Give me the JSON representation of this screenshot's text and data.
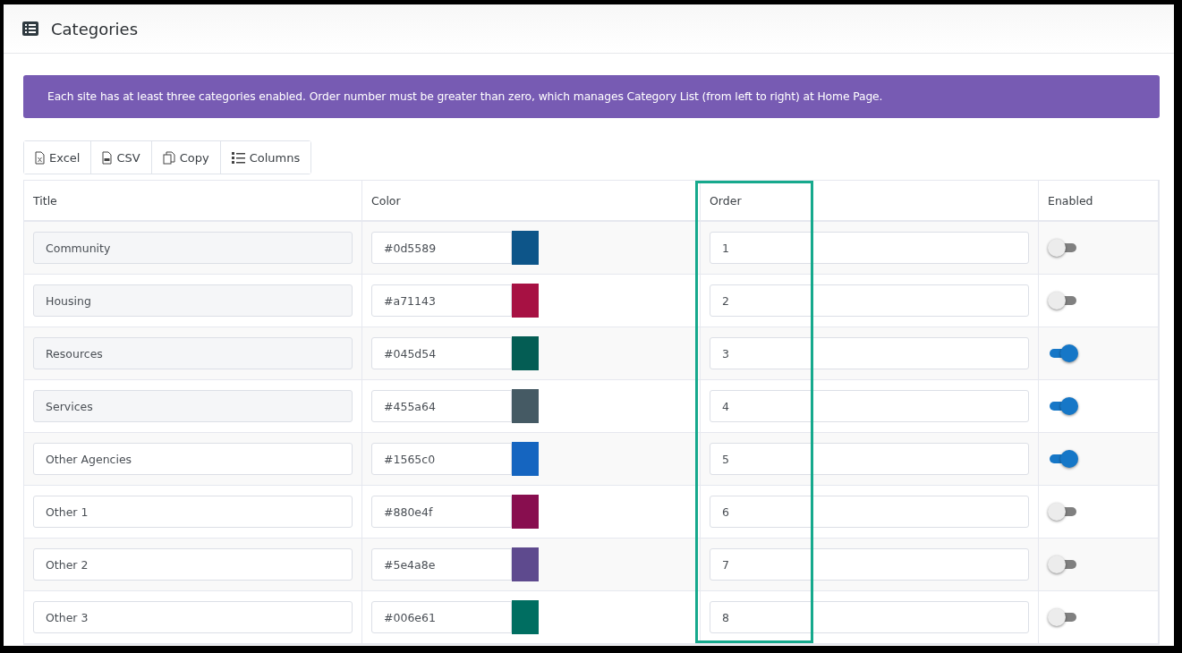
{
  "header": {
    "title": "Categories"
  },
  "alert": {
    "text": "Each site has at least three categories enabled. Order number must be greater than zero, which manages Category List (from left to right) at Home Page."
  },
  "toolbar": [
    {
      "label": "Excel",
      "kind": "excel"
    },
    {
      "label": "CSV",
      "kind": "csv"
    },
    {
      "label": "Copy",
      "kind": "copy"
    },
    {
      "label": "Columns",
      "kind": "columns"
    }
  ],
  "table": {
    "columns": [
      {
        "label": "Title",
        "highlighted": false
      },
      {
        "label": "Color",
        "highlighted": false
      },
      {
        "label": "Order",
        "highlighted": true
      },
      {
        "label": "Enabled",
        "highlighted": false
      }
    ],
    "rows": [
      {
        "title": "Community",
        "disabled": true,
        "color_value": "#0d5589",
        "color": "#0d5589",
        "order": "1",
        "enabled": false
      },
      {
        "title": "Housing",
        "disabled": true,
        "color_value": "#a71143",
        "color": "#a71143",
        "order": "2",
        "enabled": false
      },
      {
        "title": "Resources",
        "disabled": true,
        "color_value": "#045d54",
        "color": "#045d54",
        "order": "3",
        "enabled": true
      },
      {
        "title": "Services",
        "disabled": true,
        "color_value": "#455a64",
        "color": "#455a64",
        "order": "4",
        "enabled": true
      },
      {
        "title": "Other Agencies",
        "disabled": false,
        "color_value": "#1565c0",
        "color": "#1565c0",
        "order": "5",
        "enabled": true
      },
      {
        "title": "Other 1",
        "disabled": false,
        "color_value": "#880e4f",
        "color": "#880e4f",
        "order": "6",
        "enabled": false
      },
      {
        "title": "Other 2",
        "disabled": false,
        "color_value": "#5e4a8e",
        "color": "#5e4a8e",
        "order": "7",
        "enabled": false
      },
      {
        "title": "Other 3",
        "disabled": false,
        "color_value": "#006e61",
        "color": "#006e61",
        "order": "8",
        "enabled": false
      }
    ]
  }
}
